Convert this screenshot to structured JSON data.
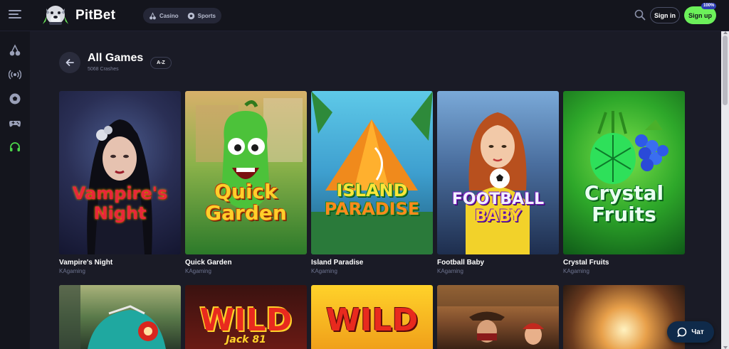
{
  "header": {
    "logo_text": "PitBet",
    "nav": [
      {
        "label": "Casino",
        "icon": "cherries-icon"
      },
      {
        "label": "Sports",
        "icon": "soccer-ball-icon"
      }
    ],
    "signin_label": "Sign in",
    "signup_label": "Sign up",
    "signup_badge": "100%",
    "accent_color": "#6cf05a"
  },
  "sidebar": {
    "items": [
      {
        "icon": "cherries-icon",
        "active": false
      },
      {
        "icon": "live-broadcast-icon",
        "active": false
      },
      {
        "icon": "soccer-ball-icon",
        "active": false
      },
      {
        "icon": "gamepad-icon",
        "active": false
      },
      {
        "icon": "headset-icon",
        "active": true
      }
    ]
  },
  "main": {
    "title": "All Games",
    "subtitle": "5068 Crashes",
    "sort_label": "A-Z",
    "games": [
      {
        "name": "Vampire's Night",
        "provider": "KAgaming",
        "art_line1": "Vampire's",
        "art_line2": "Night"
      },
      {
        "name": "Quick Garden",
        "provider": "KAgaming",
        "art_line1": "Quick",
        "art_line2": "Garden"
      },
      {
        "name": "Island Paradise",
        "provider": "KAgaming",
        "art_line1": "ISLAND",
        "art_line2": "PARADISE"
      },
      {
        "name": "Football Baby",
        "provider": "KAgaming",
        "art_line1": "FOOTBALL",
        "art_line2": "BABY"
      },
      {
        "name": "Crystal Fruits",
        "provider": "KAgaming",
        "art_line1": "Crystal",
        "art_line2": "Fruits"
      }
    ],
    "row2_art": [
      "",
      "WILD",
      "WILD",
      "",
      ""
    ],
    "row2_sub": [
      "",
      "Jack 81",
      "",
      "",
      ""
    ]
  },
  "chat": {
    "label": "Чат"
  }
}
